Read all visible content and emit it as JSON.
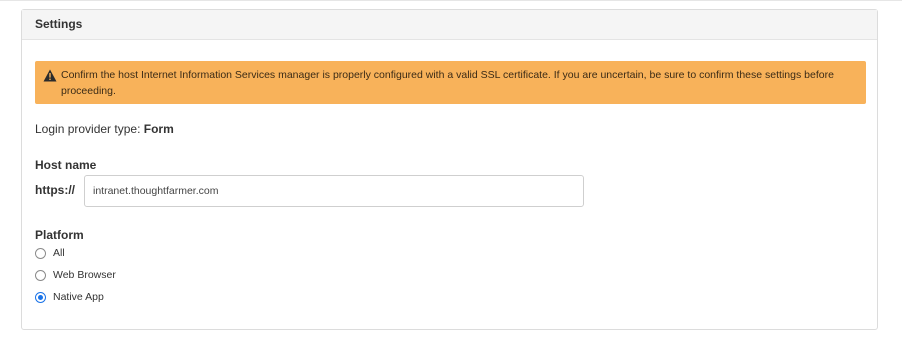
{
  "panel": {
    "title": "Settings"
  },
  "alert": {
    "icon": "warning-triangle-icon",
    "text": "Confirm the host Internet Information Services manager is properly configured with a valid SSL certificate. If you are uncertain, be sure to confirm these settings before proceeding.",
    "background_color": "#f8b25a"
  },
  "login_provider": {
    "label": "Login provider type:",
    "value": "Form"
  },
  "host": {
    "label": "Host name",
    "prefix": "https://",
    "value": "intranet.thoughtfarmer.com"
  },
  "platform": {
    "label": "Platform",
    "options": [
      {
        "label": "All",
        "checked": false
      },
      {
        "label": "Web Browser",
        "checked": false
      },
      {
        "label": "Native App",
        "checked": true
      }
    ],
    "accent_color": "#1a73e8"
  }
}
